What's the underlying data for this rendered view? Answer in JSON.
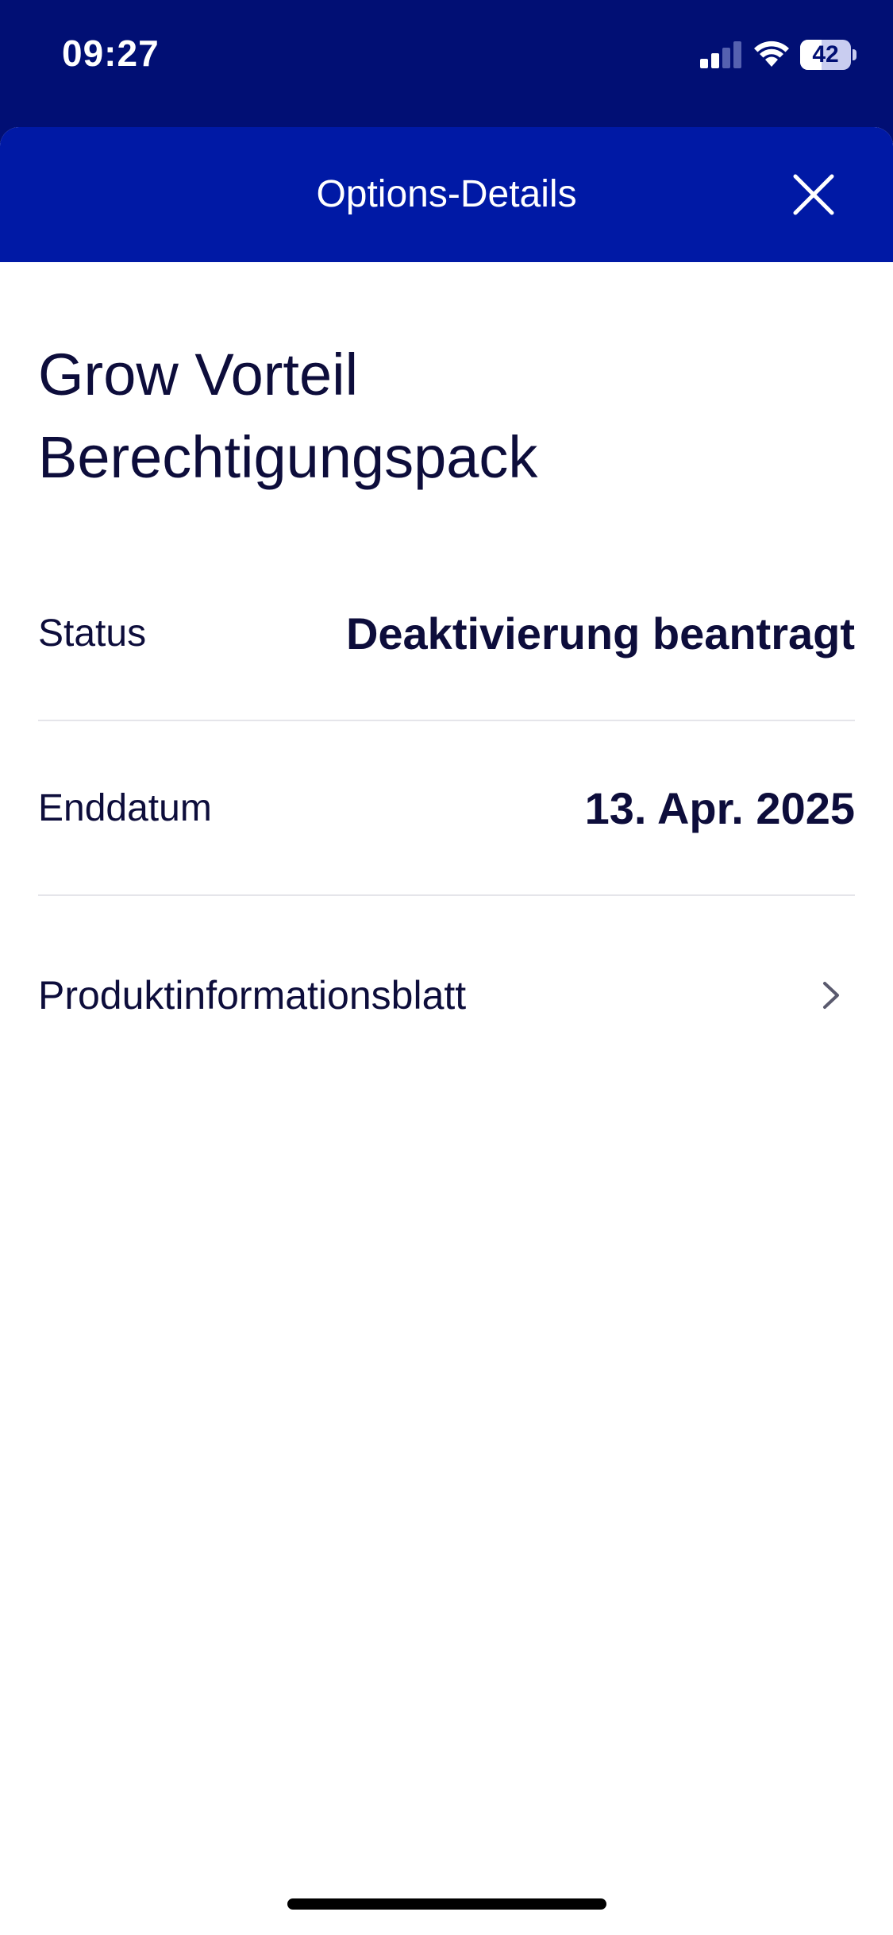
{
  "status_bar": {
    "time": "09:27",
    "battery_percent": 42,
    "battery_label": "42",
    "signal_bars_active": 2,
    "signal_bars_total": 4,
    "icons": [
      "cellular-signal-icon",
      "wifi-icon",
      "battery-icon"
    ]
  },
  "header": {
    "title": "Options-Details",
    "close_icon": "close-icon"
  },
  "product": {
    "title_line1": "Grow Vorteil",
    "title_line2": "Berechtigungspack"
  },
  "details": [
    {
      "label": "Status",
      "value": "Deaktivierung beantragt"
    },
    {
      "label": "Enddatum",
      "value": "13. Apr. 2025"
    }
  ],
  "links": [
    {
      "label": "Produktinformationsblatt",
      "icon": "chevron-right-icon"
    }
  ],
  "colors": {
    "status_bar_bg": "#010f74",
    "header_bg": "#0019a5",
    "text_primary": "#0d0d3b",
    "divider": "#e5e5ea"
  }
}
